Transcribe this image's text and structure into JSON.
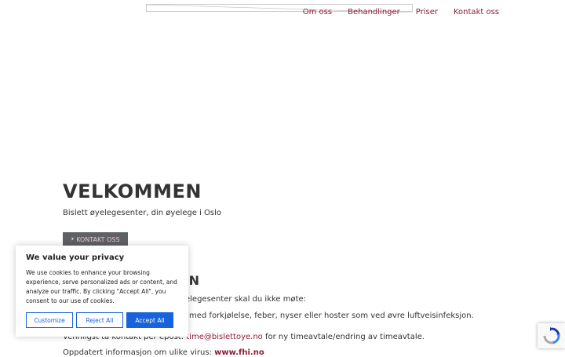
{
  "nav": {
    "items": [
      "Om oss",
      "Behandlinger",
      "Priser",
      "Kontakt oss"
    ]
  },
  "hero": {
    "title": "VELKOMMEN",
    "subtitle": "Bislett øyelegesenter, din øyelege i Oslo",
    "button_label": "KONTAKT OSS"
  },
  "info": {
    "heading_fragment": "ON",
    "line1": "elegesenter skal du ikke møte:",
    "line2": "med forkjølelse, feber, nyser eller hoster som ved øvre luftveisinfeksjon.",
    "line3_prefix": "Vennligst ta kontakt per epost: ",
    "line3_email": "time@bislettoye.no",
    "line3_suffix": " for ny timeavtale/endring av timeavtale.",
    "line4_prefix": "Oppdatert informasjon om ulike virus: ",
    "line4_link": "www.fhi.no"
  },
  "cookie": {
    "title": "We value your privacy",
    "text": "We use cookies to enhance your browsing experience, serve personalized ads or content, and analyze our traffic. By clicking \"Accept All\", you consent to our use of cookies.",
    "customize": "Customize",
    "reject": "Reject All",
    "accept": "Accept All"
  },
  "colors": {
    "link": "#8e1d33",
    "cookie_accent": "#1863dc",
    "button_bg": "#5f6167"
  },
  "icons": {
    "logo": "broken-image-icon",
    "button_chevron": "chevron-right-icon",
    "recaptcha": "recaptcha-icon"
  }
}
